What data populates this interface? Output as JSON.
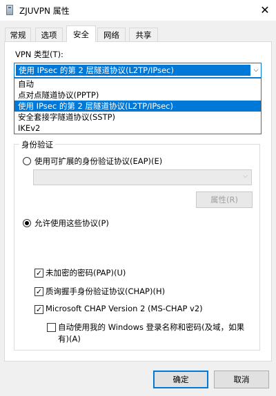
{
  "window": {
    "title": "ZJUVPN 属性",
    "close_glyph": "✕",
    "icon": "network-connection-icon"
  },
  "tabs": [
    {
      "label": "常规",
      "active": false
    },
    {
      "label": "选项",
      "active": false
    },
    {
      "label": "安全",
      "active": true
    },
    {
      "label": "网络",
      "active": false
    },
    {
      "label": "共享",
      "active": false
    }
  ],
  "vpn_type": {
    "label": "VPN 类型(T):",
    "selected": "使用 IPsec 的第 2 层隧道协议(L2TP/IPsec)",
    "options": [
      "自动",
      "点对点隧道协议(PPTP)",
      "使用 IPsec 的第 2 层隧道协议(L2TP/IPsec)",
      "安全套接字隧道协议(SSTP)",
      "IKEv2"
    ],
    "highlighted_index": 2
  },
  "auth": {
    "group_title": "身份验证",
    "eap_radio_label": "使用可扩展的身份验证协议(EAP)(E)",
    "eap_selected": false,
    "eap_properties_button": "属性(R)",
    "allow_radio_label": "允许使用这些协议(P)",
    "allow_selected": true,
    "protocols": [
      {
        "label": "未加密的密码(PAP)(U)",
        "checked": true
      },
      {
        "label": "质询握手身份验证协议(CHAP)(H)",
        "checked": true
      },
      {
        "label": "Microsoft CHAP Version 2 (MS-CHAP v2)",
        "checked": true
      }
    ],
    "auto_logon_line1": "自动使用我的 Windows 登录名称和密码(及域，如果",
    "auto_logon_line2": "有)(A)",
    "auto_logon_checked": false
  },
  "buttons": {
    "ok": "确定",
    "cancel": "取消"
  },
  "check_glyph": "✓",
  "arrow_glyph": "⌵"
}
